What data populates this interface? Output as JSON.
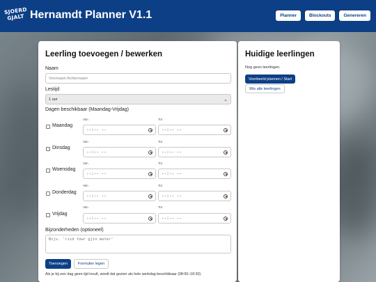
{
  "header": {
    "logo_line1": "SJOERD",
    "logo_line2": "GJALT",
    "title": "Hernamdt Planner V1.1",
    "nav": [
      "Planner",
      "Blockouts",
      "Genereren"
    ]
  },
  "form": {
    "heading": "Leerling toevoegen / bewerken",
    "name_label": "Naam",
    "name_placeholder": "Voornaam Achternaam",
    "lesson_label": "Lestijd",
    "lesson_value": "1 uur",
    "days_label": "Dagen beschikbaar (Maandag-Vrijdag)",
    "from_label": "Van",
    "to_label": "Tot",
    "time_placeholder": "--:-- --",
    "days": [
      "Maandag",
      "Dinsdag",
      "Woensdag",
      "Donderdag",
      "Vrijdag"
    ],
    "notes_label": "Bijzonderheden (optioneel)",
    "notes_placeholder": "Bijv. 'riid fowr gjin meter'",
    "add_button": "Toevoegen",
    "clear_button": "Formulier legen",
    "hint": "Als je bij een dag geen tijd invult, wordt dat gezien als hele werkdag beschikbaar (08:00–18:30)."
  },
  "students": {
    "heading": "Huidige leerlingen",
    "empty_text": "Nog geen leerlingen.",
    "example_button": "Voorbeeld plannen / Start",
    "clear_all_button": "Wis alle leerlingen"
  },
  "colors": {
    "brand": "#0d3f86"
  }
}
